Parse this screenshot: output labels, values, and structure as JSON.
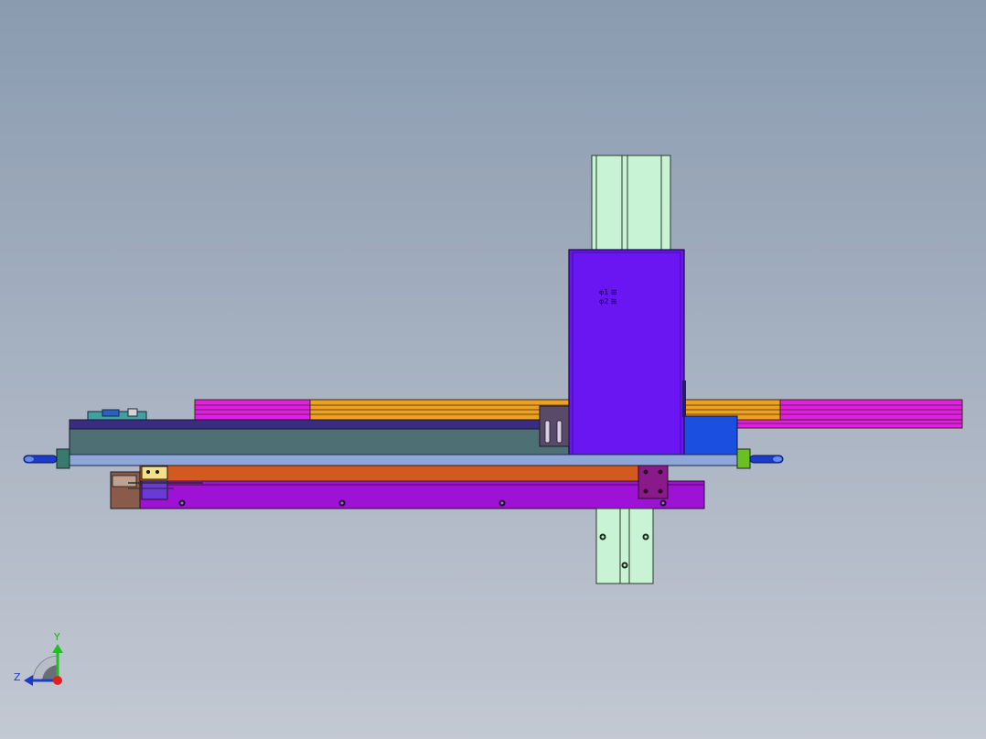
{
  "scene": {
    "plate_marks": [
      "φ1 ⊞",
      "φ2 ⊞"
    ],
    "triad_axes": [
      "Y",
      "Z"
    ]
  },
  "colors": {
    "background_top": "#8a9bb0",
    "background_bottom": "#c3c8d2",
    "column_guide": "#c8f3d4",
    "slider_plate": "#6a16f2",
    "rail_magenta": "#e21ee6",
    "rail_orange": "#f0a020",
    "base_beam": "#4e7075",
    "carriage_bar": "#d25a20",
    "lower_rail": "#9d12d4",
    "axis_y": "#20c020",
    "axis_z": "#1a3cc8",
    "axis_origin": "#e02020"
  }
}
